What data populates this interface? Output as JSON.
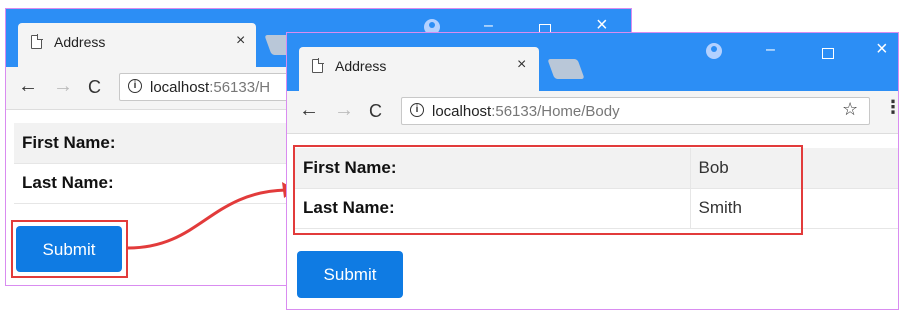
{
  "back_window": {
    "tab_title": "Address",
    "url_host": "localhost",
    "url_path": ":56133/H",
    "rows": [
      {
        "label": "First Name:"
      },
      {
        "label": "Last Name:"
      }
    ],
    "submit_label": "Submit"
  },
  "front_window": {
    "tab_title": "Address",
    "url_host": "localhost",
    "url_path": ":56133/Home/Body",
    "rows": [
      {
        "label": "First Name:",
        "value": "Bob"
      },
      {
        "label": "Last Name:",
        "value": "Smith"
      }
    ],
    "submit_label": "Submit"
  },
  "glyphs": {
    "close": "×",
    "minimize": "–",
    "back": "←",
    "forward": "→",
    "reload": "C",
    "info": "i",
    "star": "☆",
    "menu": "⋮"
  },
  "colors": {
    "titlebar": "#2c8ef5",
    "submit": "#0f7be3",
    "highlight": "#e23b3b",
    "window_border": "#d98cf0"
  }
}
